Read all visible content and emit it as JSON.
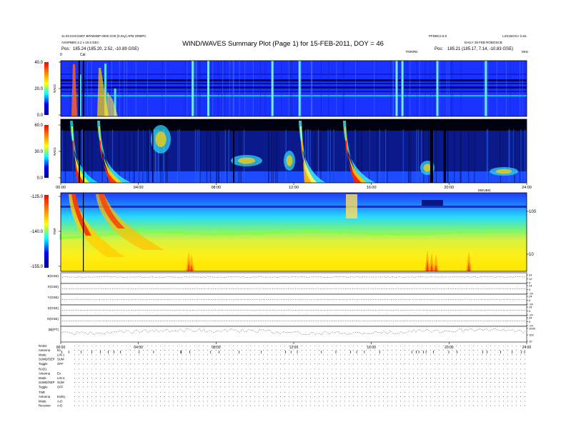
{
  "header": {
    "title": "WIND/WAVES Summary Plot (Page 1) for 15-FEB-2011, DOY = 46",
    "left_line1": "11.03 KOC/2007 BPABSBP 0000 0:00 (0.0sy) APB.ORBPC",
    "left_line2": "ASSPBBS 2.2 x 10.0 DEC",
    "left_pos_label": "Pos:",
    "left_pos_value": "185.24 (185.20, 2.52, -10.89 GSE)",
    "right_line1": "PFDBC2.8.0",
    "right_line2": "L2S15C01+ b.61",
    "right_line3": "DAILY 29 FEB ROBOSCB",
    "right_pos_label": "Pos:",
    "right_pos_value": "185.21 (185.17, 7.14, -10.83 GSE)"
  },
  "chart_data": [
    {
      "type": "heatmap",
      "id": "rad2",
      "panel_label": "RAD2",
      "ylim": [
        0,
        40
      ],
      "yticks": [
        {
          "value": 40,
          "label": "40.0"
        },
        {
          "value": 20,
          "label": "20.0"
        },
        {
          "value": 0,
          "label": "0.0"
        }
      ],
      "xlim": [
        0,
        24
      ],
      "marker_labels": [
        "0",
        "Cal"
      ],
      "label_tnr": "TNR/RD",
      "label_top_right": "MHz",
      "events": [
        {
          "t": 1.0,
          "f": 30
        },
        {
          "t": 2.3,
          "f": 38
        },
        {
          "t": 2.8,
          "f": 20
        },
        {
          "t": 6.8,
          "f": 40
        },
        {
          "t": 7.6,
          "f": 40
        },
        {
          "t": 10.9,
          "f": 40
        },
        {
          "t": 12.3,
          "f": 40
        },
        {
          "t": 17.3,
          "f": 40
        },
        {
          "t": 17.6,
          "f": 40
        },
        {
          "t": 19.4,
          "f": 40
        },
        {
          "t": 21.9,
          "f": 40
        }
      ]
    },
    {
      "type": "heatmap",
      "id": "rad1",
      "panel_label": "RAD1",
      "ylim": [
        0,
        60
      ],
      "yticks": [
        {
          "value": 60,
          "label": "60.0"
        },
        {
          "value": 30,
          "label": "30.0"
        },
        {
          "value": 0,
          "label": "0.0"
        }
      ],
      "xlim": [
        0,
        24
      ],
      "xticks": [
        "00:00",
        "04:00",
        "08:00",
        "12:00",
        "16:00",
        "20:00",
        "24:00"
      ],
      "events": [
        {
          "t": 0.9,
          "f": 60
        },
        {
          "t": 2.3,
          "f": 50
        },
        {
          "t": 5.1,
          "f": 45
        },
        {
          "t": 8.3,
          "f": 20
        },
        {
          "t": 11.5,
          "f": 25
        },
        {
          "t": 12.7,
          "f": 30
        },
        {
          "t": 15.2,
          "f": 45
        },
        {
          "t": 17.8,
          "f": 15
        },
        {
          "t": 22.5,
          "f": 10
        }
      ]
    },
    {
      "type": "heatmap",
      "id": "tnr",
      "panel_label": "TNR",
      "ylim": [
        -155,
        -125
      ],
      "yticks": [
        {
          "value": -125,
          "label": "-125.0"
        },
        {
          "value": -140,
          "label": "-140.0"
        },
        {
          "value": -155,
          "label": "-155.0"
        }
      ],
      "right_ticks": [
        "100",
        "10"
      ],
      "label_top_right": "DB/UBIC",
      "xlim": [
        0,
        24
      ]
    },
    {
      "type": "line",
      "id": "mag",
      "xlim": [
        0,
        24
      ],
      "xticks": [
        "00:00",
        "04:00",
        "08:00",
        "12:00",
        "16:00",
        "20:00",
        "24:00"
      ],
      "series": [
        {
          "name": "B(GSE)",
          "right": [
            "24",
            "12",
            "0"
          ],
          "base": 0.4,
          "noise": 0.08
        },
        {
          "name": "X(GSE)",
          "right": [
            "24",
            "0",
            "-24"
          ],
          "base": 0.5,
          "noise": 0.05
        },
        {
          "name": "Y(GSE)",
          "right": [
            "24",
            "0",
            "-24"
          ],
          "base": 0.5,
          "noise": 0.05
        },
        {
          "name": "Z(GSE)",
          "right": [
            "24",
            "0",
            "-24"
          ],
          "base": 0.5,
          "noise": 0.05
        },
        {
          "name": "N(GSE)",
          "right": [
            "24",
            "0",
            "-24"
          ],
          "base": 0.5,
          "noise": 0.05
        },
        {
          "name": "|B|(PT)",
          "right": [
            "1000",
            "100",
            "10"
          ],
          "base": 0.35,
          "noise": 0.25
        }
      ]
    }
  ],
  "settings": {
    "rad2": [
      {
        "k": "RAD2",
        "v": ""
      },
      {
        "k": "Antenna",
        "v": "Ex"
      },
      {
        "k": "Mode",
        "v": "LIN 1"
      },
      {
        "k": "SUMD/SEP",
        "v": "SUM"
      },
      {
        "k": "Toggle",
        "v": "OFF"
      }
    ],
    "rad1": [
      {
        "k": "RAD1",
        "v": ""
      },
      {
        "k": "Antenna",
        "v": "Ex"
      },
      {
        "k": "Mode",
        "v": "LIN 4"
      },
      {
        "k": "SUMD/SEP",
        "v": "SUM"
      },
      {
        "k": "Toggle",
        "v": "OFF"
      }
    ],
    "tnr": [
      {
        "k": "TNR",
        "v": ""
      },
      {
        "k": "Antenna",
        "v": "Ex/Ey"
      },
      {
        "k": "Mode",
        "v": "A-D"
      },
      {
        "k": "Receiver",
        "v": "A-D"
      }
    ]
  }
}
